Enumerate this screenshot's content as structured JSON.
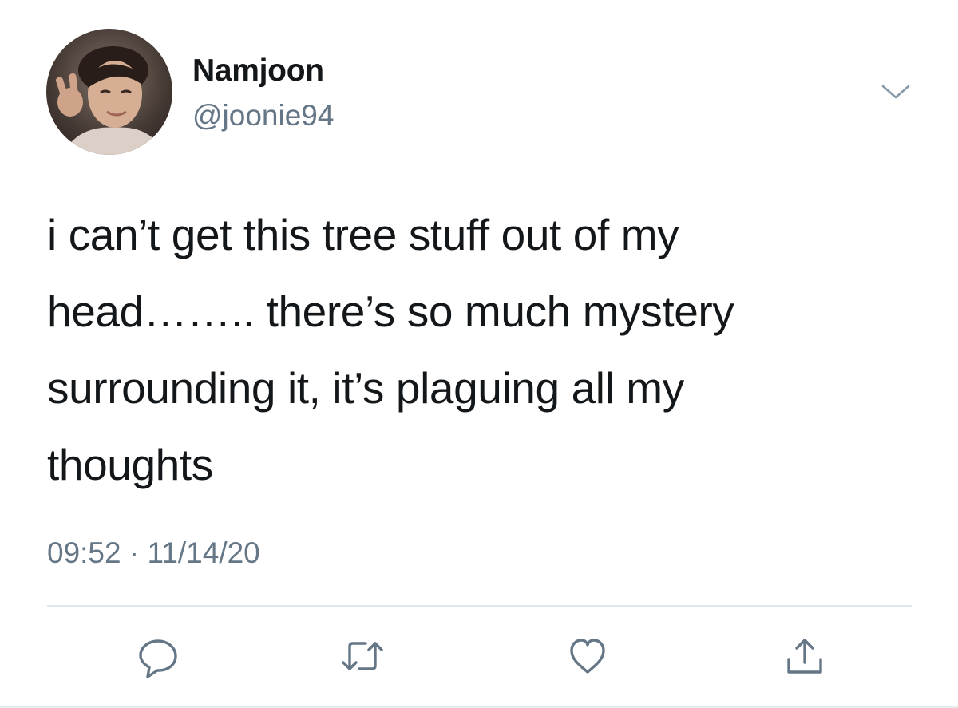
{
  "tweet": {
    "author": {
      "name": "Namjoon",
      "handle": "@joonie94"
    },
    "text_lines": [
      "i can’t get this tree stuff out of my",
      "head…….. there’s so much mystery",
      "surrounding it, it’s plaguing all my",
      "thoughts"
    ],
    "time": "09:52",
    "separator": "·",
    "date": "11/14/20"
  },
  "icons": {
    "more": "chevron-down-icon",
    "reply": "reply-icon",
    "retweet": "retweet-icon",
    "like": "heart-icon",
    "share": "share-icon"
  },
  "colors": {
    "text": "#14171a",
    "secondary": "#657786",
    "divider": "#e1e8ed",
    "icon": "#657786"
  }
}
